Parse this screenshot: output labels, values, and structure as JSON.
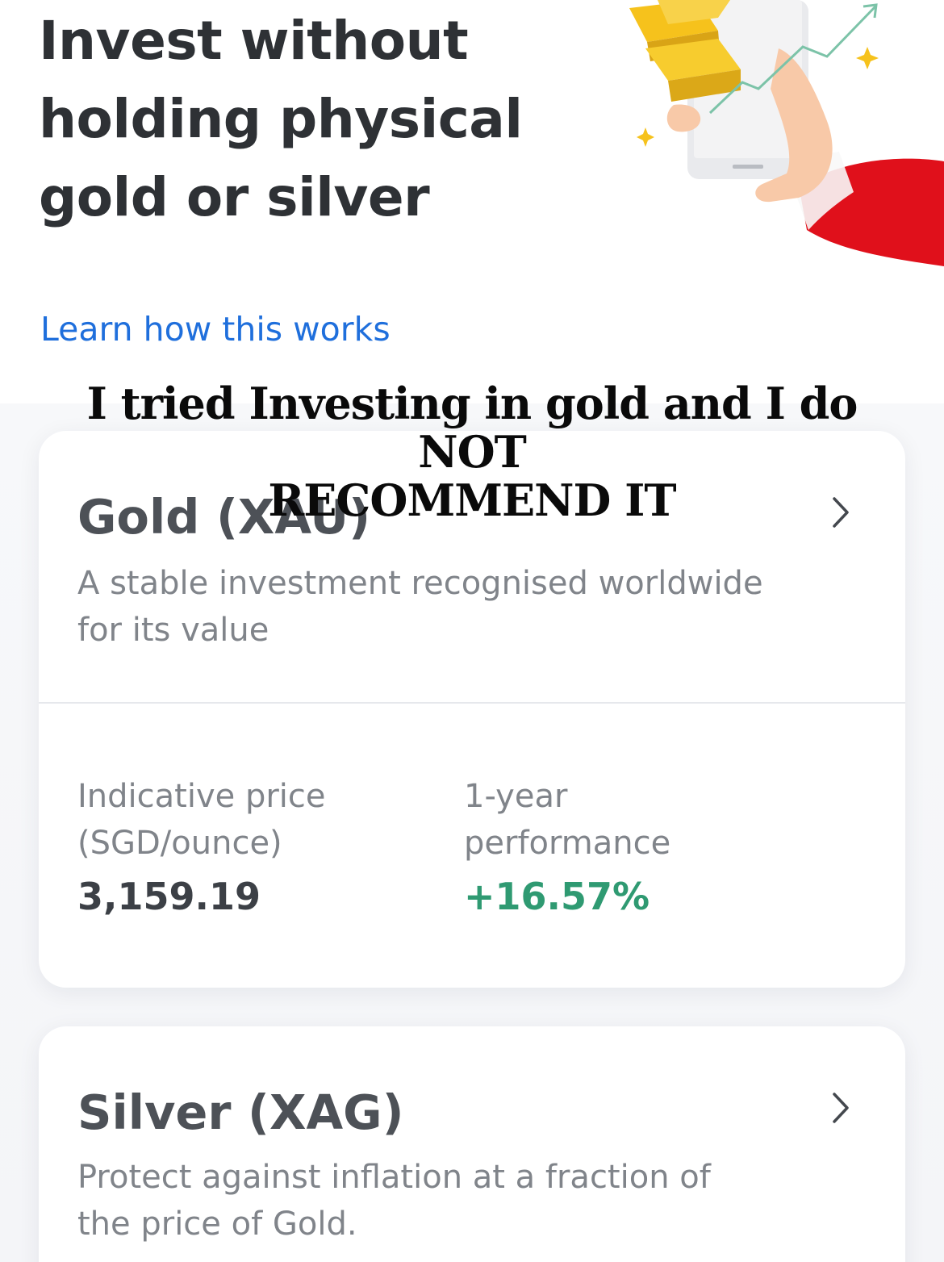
{
  "hero": {
    "title_line1": "Invest without",
    "title_line2": "holding physical",
    "title_line3": "gold or silver"
  },
  "learn_link": "Learn how this works",
  "caption_overlay": {
    "line1": "I tried Investing in gold and I do NOT",
    "line2": "RECOMMEND IT"
  },
  "products": [
    {
      "title": "Gold (XAU)",
      "description": "A stable investment recognised worldwide for its value",
      "price_label": "Indicative price (SGD/ounce)",
      "price_value": "3,159.19",
      "performance_label": "1-year performance",
      "performance_value": "+16.57%"
    },
    {
      "title": "Silver (XAG)",
      "description": "Protect against inflation at a fraction of the price of Gold."
    }
  ],
  "colors": {
    "link": "#1f6fdc",
    "positive": "#2f9a72",
    "accent_red": "#e0101b",
    "gold": "#f6c21c"
  },
  "icons": [
    "chevron-right-icon",
    "phone-chart-illustration"
  ]
}
